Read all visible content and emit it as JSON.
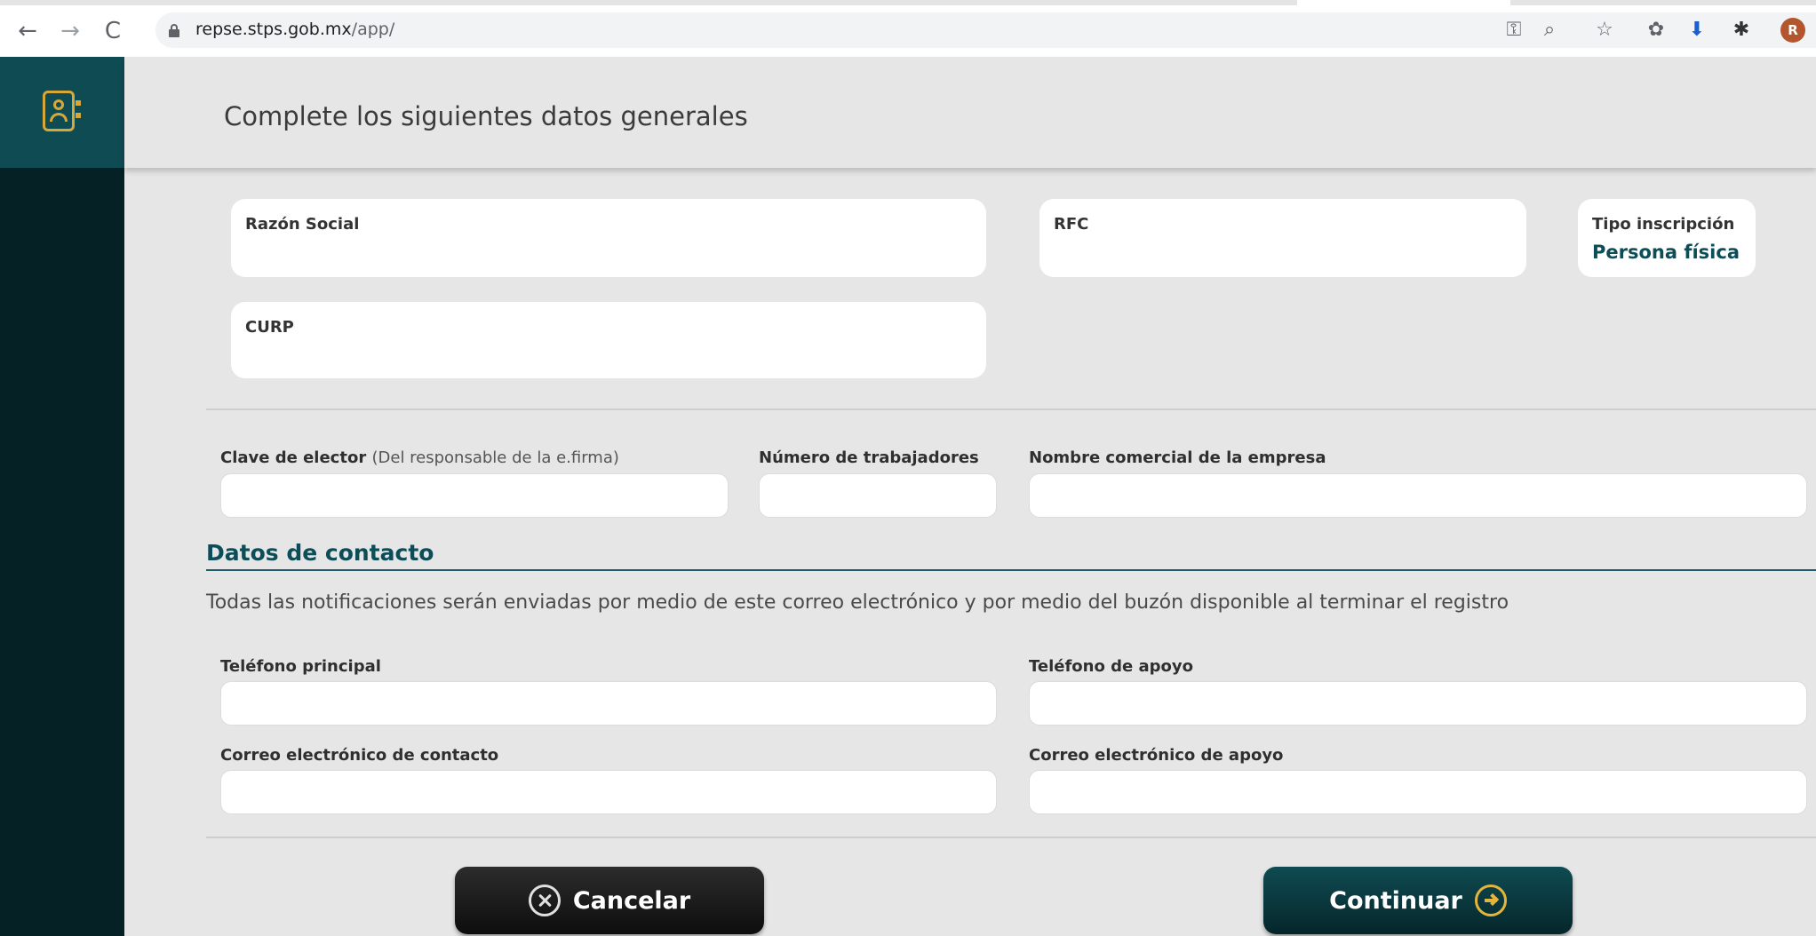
{
  "browser": {
    "back_icon": "←",
    "forward_icon": "→",
    "reload_icon": "C",
    "url_host": "repse.stps.gob.mx",
    "url_path": "/app/",
    "toolbar_icons": [
      "key-icon",
      "zoom-icon",
      "star-icon",
      "extension-icon",
      "download-icon",
      "puzzle-icon"
    ],
    "avatar_initial": "R"
  },
  "header": {
    "title": "Complete los siguientes datos generales"
  },
  "info_cards": {
    "razon_social": {
      "label": "Razón Social",
      "value": ""
    },
    "rfc": {
      "label": "RFC",
      "value": ""
    },
    "tipo_inscripcion": {
      "label": "Tipo inscripción",
      "value": "Persona física"
    },
    "curp": {
      "label": "CURP",
      "value": ""
    }
  },
  "fields": {
    "clave_elector": {
      "label": "Clave de elector",
      "hint": "(Del responsable de la e.firma)",
      "value": ""
    },
    "numero_trabajadores": {
      "label": "Número de trabajadores",
      "value": ""
    },
    "nombre_comercial": {
      "label": "Nombre comercial de la empresa",
      "value": ""
    }
  },
  "contacto": {
    "title": "Datos de contacto",
    "note": "Todas las notificaciones serán enviadas por medio de este correo electrónico y por medio del buzón disponible al terminar el registro",
    "telefono_principal": {
      "label": "Teléfono principal",
      "value": ""
    },
    "telefono_apoyo": {
      "label": "Teléfono de apoyo",
      "value": ""
    },
    "correo_contacto": {
      "label": "Correo electrónico de contacto",
      "value": ""
    },
    "correo_apoyo": {
      "label": "Correo electrónico de apoyo",
      "value": ""
    }
  },
  "actions": {
    "cancel_label": "Cancelar",
    "continue_label": "Continuar"
  },
  "colors": {
    "sidebar": "#062125",
    "sidebar_accent": "#0f4b52",
    "icon_gold": "#d7a838",
    "brand_text": "#0c4d58"
  }
}
